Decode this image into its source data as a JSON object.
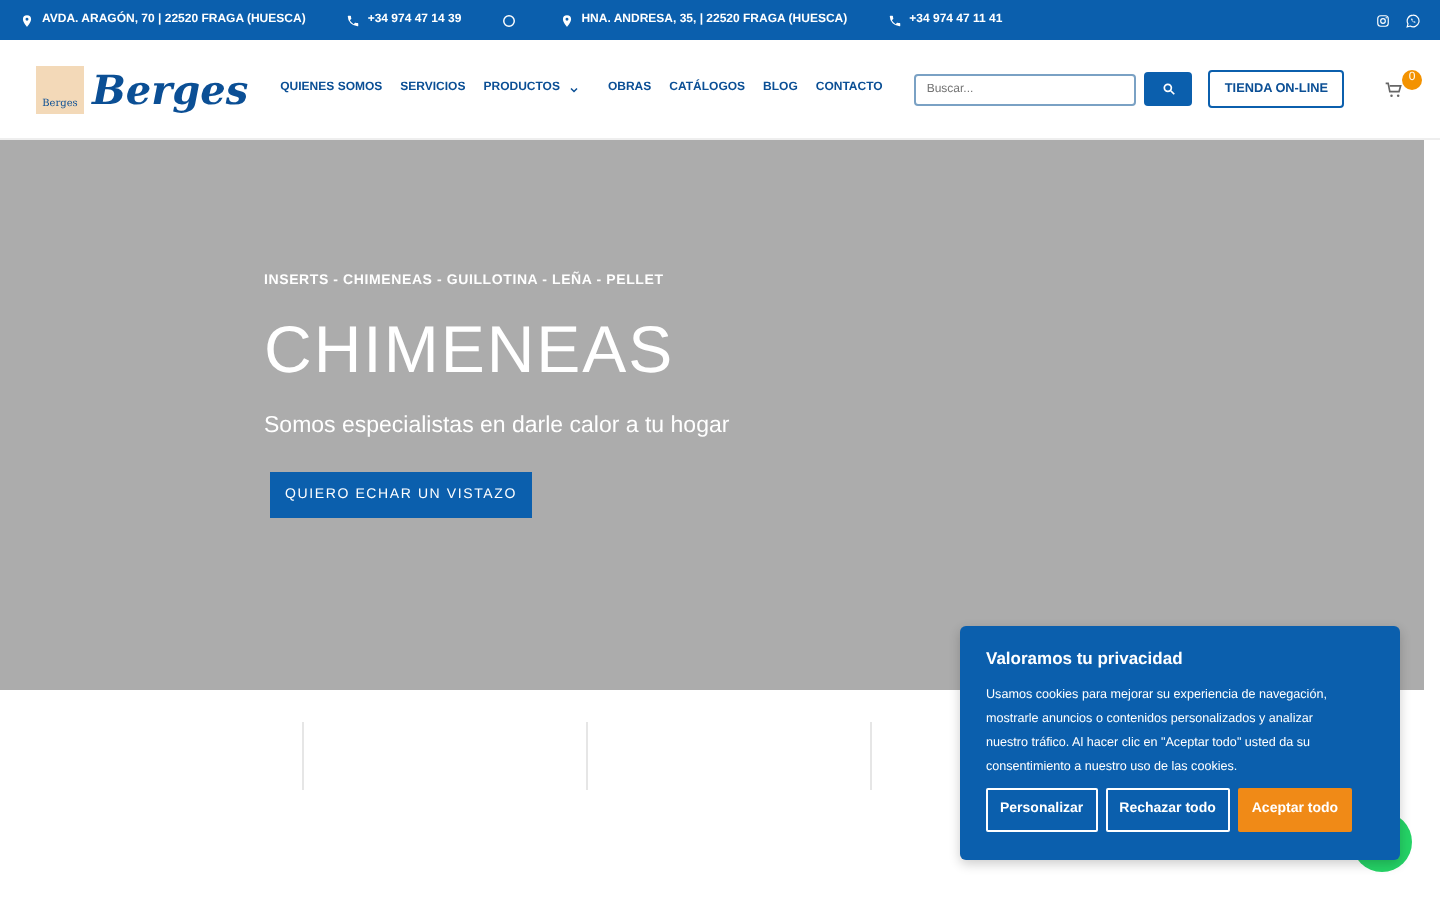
{
  "top_bar": {
    "items": [
      {
        "kind": "address",
        "text": "AVDA. ARAGÓN, 70 | 22520 FRAGA (HUESCA)"
      },
      {
        "kind": "phone",
        "text": "+34 974 47 14 39"
      },
      {
        "kind": "dot"
      },
      {
        "kind": "address",
        "text": "HNA. ANDRESA, 35, | 22520 FRAGA (HUESCA)"
      },
      {
        "kind": "phone",
        "text": "+34 974 47 11 41"
      }
    ]
  },
  "header": {
    "logo_badge": "Berges",
    "logo_text": "Berges",
    "nav": [
      {
        "label": "QUIENES SOMOS",
        "dropdown": false
      },
      {
        "label": "SERVICIOS",
        "dropdown": false
      },
      {
        "label": "PRODUCTOS",
        "dropdown": true
      },
      {
        "label": "OBRAS",
        "dropdown": false
      },
      {
        "label": "CATÁLOGOS",
        "dropdown": false
      },
      {
        "label": "BLOG",
        "dropdown": false
      },
      {
        "label": "CONTACTO",
        "dropdown": false
      }
    ],
    "search": {
      "placeholder": "Buscar..."
    },
    "shop_button": "TIENDA ON-LINE",
    "cart_count": "0"
  },
  "hero": {
    "eyebrow": "INSERTS - CHIMENEAS - GUILLOTINA - LEÑA - PELLET",
    "title": "CHIMENEAS",
    "subtitle": "Somos especialistas en darle calor a tu hogar",
    "button": "QUIERO ECHAR UN VISTAZO"
  },
  "cookie_banner": {
    "title": "Valoramos tu privacidad",
    "text": "Usamos cookies para mejorar su experiencia de navegación, mostrarle anuncios o contenidos personalizados y analizar nuestro tráfico. Al hacer clic en \"Aceptar todo\" usted da su consentimiento a nuestro uso de las cookies.",
    "buttons": [
      {
        "label": "Personalizar",
        "kind": "outline"
      },
      {
        "label": "Rechazar todo",
        "kind": "outline"
      },
      {
        "label": "Aceptar todo",
        "kind": "primary"
      }
    ]
  }
}
